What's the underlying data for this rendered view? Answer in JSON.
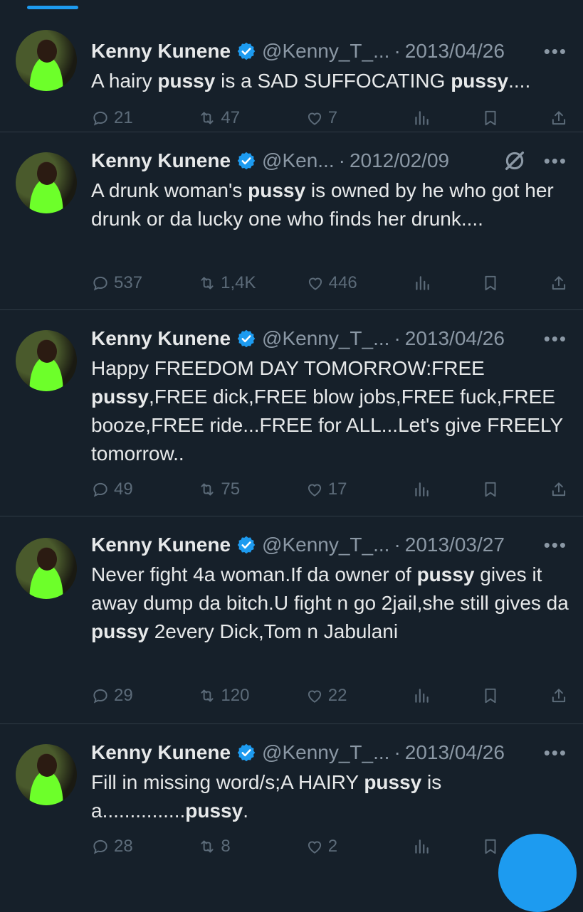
{
  "tweets": [
    {
      "name": "Kenny Kunene",
      "handle": "@Kenny_T_...",
      "date": "2013/04/26",
      "show_grok": false,
      "text_parts": [
        {
          "t": "A hairy ",
          "b": false
        },
        {
          "t": "pussy",
          "b": true
        },
        {
          "t": " is a SAD SUFFOCATING ",
          "b": false
        },
        {
          "t": "pussy",
          "b": true
        },
        {
          "t": "....",
          "b": false
        }
      ],
      "replies": "21",
      "reposts": "47",
      "likes": "7"
    },
    {
      "name": "Kenny Kunene",
      "handle": "@Ken...",
      "date": "2012/02/09",
      "show_grok": true,
      "text_parts": [
        {
          "t": "A drunk woman's ",
          "b": false
        },
        {
          "t": "pussy",
          "b": true
        },
        {
          "t": " is owned by he who got her drunk or da lucky one who finds her drunk....",
          "b": false
        }
      ],
      "replies": "537",
      "reposts": "1,4K",
      "likes": "446"
    },
    {
      "name": "Kenny Kunene",
      "handle": "@Kenny_T_...",
      "date": "2013/04/26",
      "show_grok": false,
      "text_parts": [
        {
          "t": "Happy FREEDOM DAY TOMORROW:FREE ",
          "b": false
        },
        {
          "t": "pussy",
          "b": true
        },
        {
          "t": ",FREE dick,FREE blow jobs,FREE fuck,FREE booze,FREE ride...FREE for ALL...Let's give FREELY tomorrow..",
          "b": false
        }
      ],
      "replies": "49",
      "reposts": "75",
      "likes": "17"
    },
    {
      "name": "Kenny Kunene",
      "handle": "@Kenny_T_...",
      "date": "2013/03/27",
      "show_grok": false,
      "text_parts": [
        {
          "t": "Never fight 4a woman.If da owner of ",
          "b": false
        },
        {
          "t": "pussy",
          "b": true
        },
        {
          "t": " gives it away dump da bitch.U fight n go 2jail,she still gives da ",
          "b": false
        },
        {
          "t": "pussy",
          "b": true
        },
        {
          "t": " 2every Dick,Tom n Jabulani",
          "b": false
        }
      ],
      "replies": "29",
      "reposts": "120",
      "likes": "22"
    },
    {
      "name": "Kenny Kunene",
      "handle": "@Kenny_T_...",
      "date": "2013/04/26",
      "show_grok": false,
      "text_parts": [
        {
          "t": "Fill in missing word/s;A HAIRY ",
          "b": false
        },
        {
          "t": "pussy",
          "b": true
        },
        {
          "t": " is a...............",
          "b": false
        },
        {
          "t": "pussy",
          "b": true
        },
        {
          "t": ".",
          "b": false
        }
      ],
      "replies": "28",
      "reposts": "8",
      "likes": "2"
    }
  ],
  "more_glyph": "•••",
  "colors": {
    "background": "#16202a",
    "accent": "#1d9bf0",
    "muted": "#8b98a5",
    "action": "#5c6b79",
    "text": "#e7e9ea"
  }
}
